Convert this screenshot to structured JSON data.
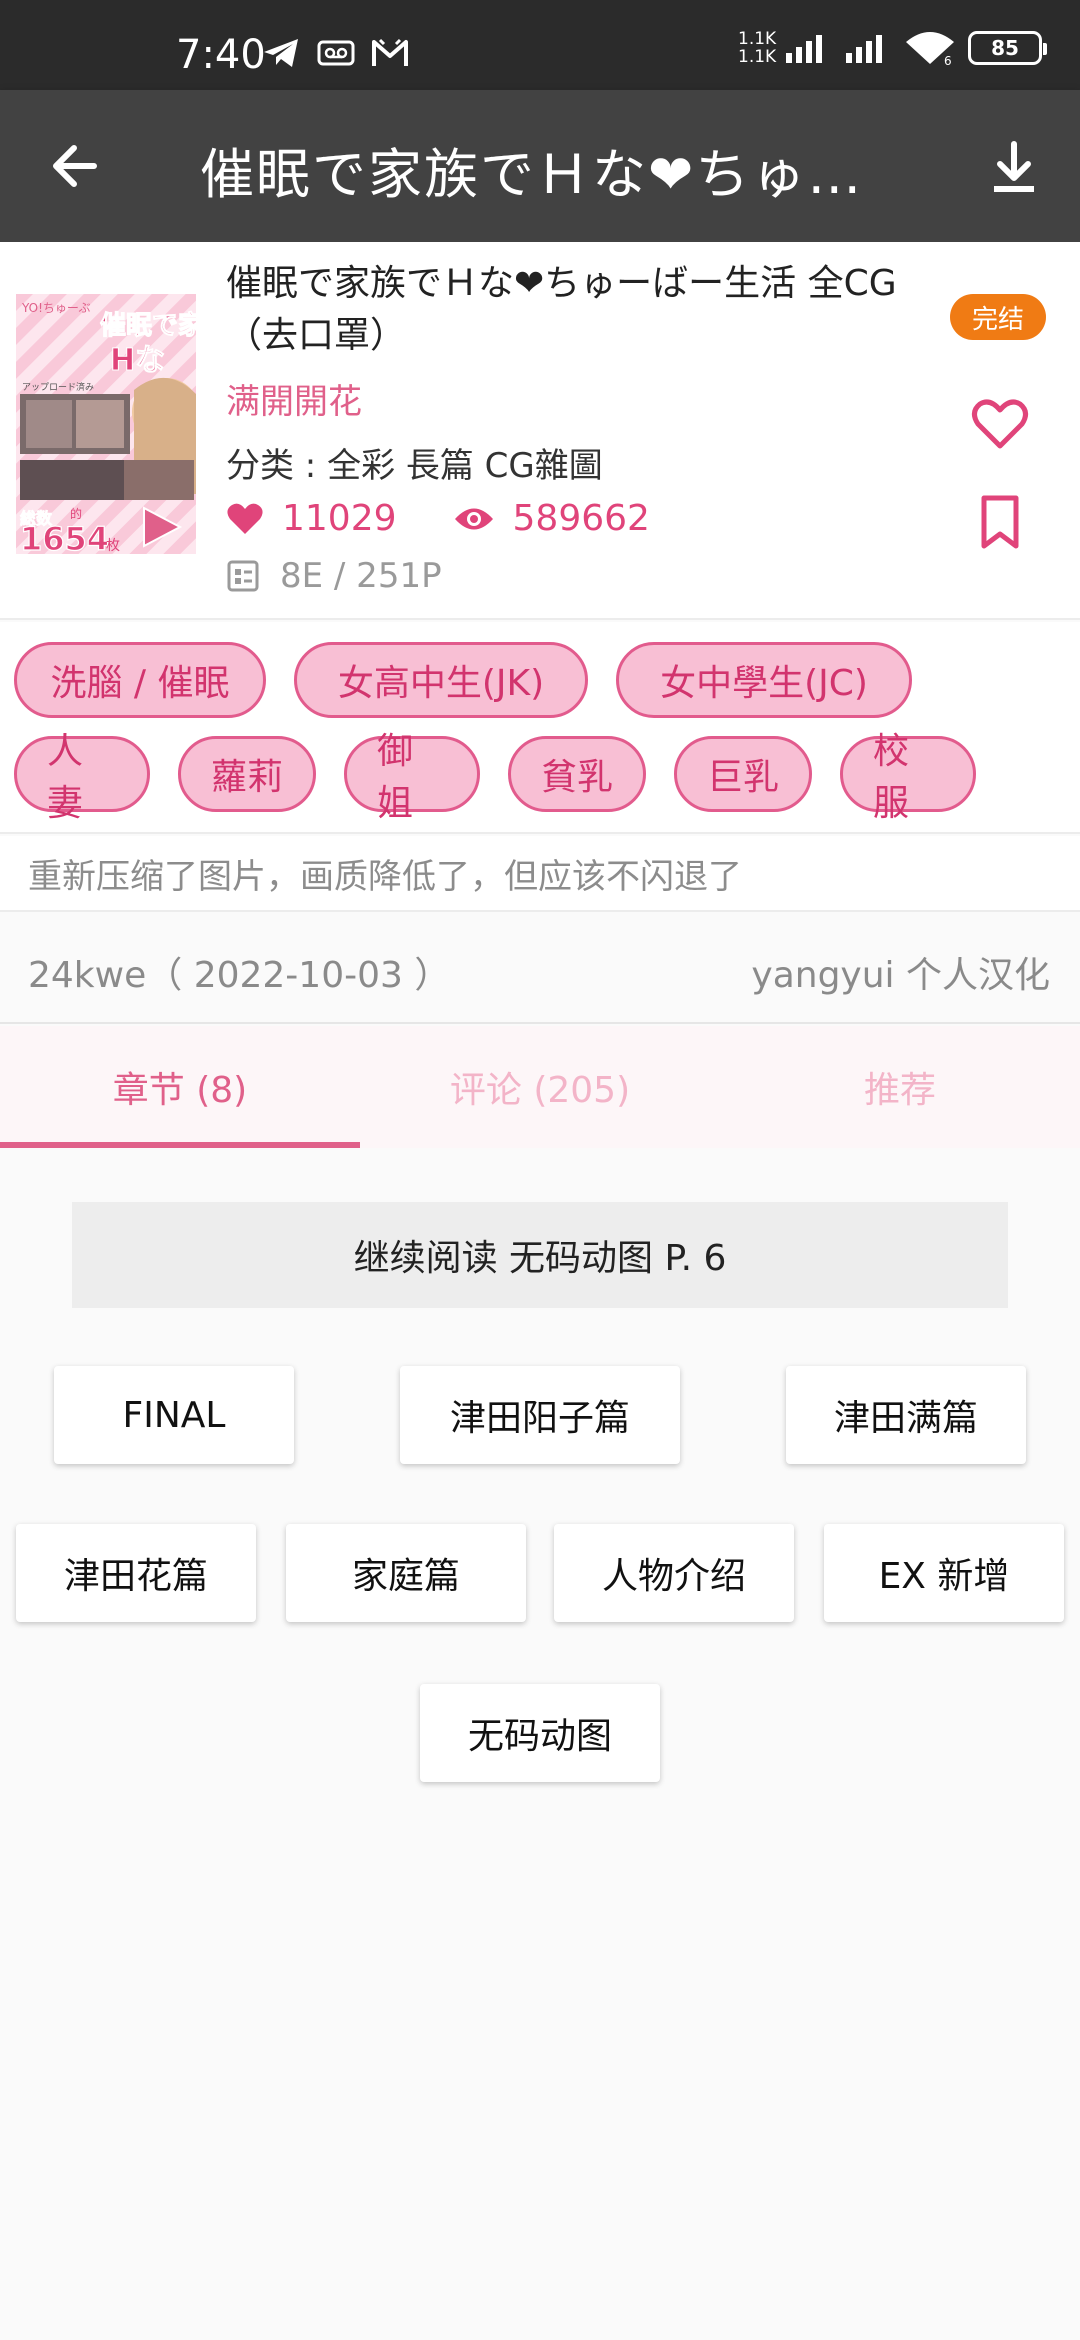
{
  "status_bar": {
    "time": "7:40",
    "net_up": "1.1K",
    "net_down": "1.1K",
    "battery": "85"
  },
  "app_bar": {
    "title": "催眠で家族でＨな❤ちゅーばー生活 全CG（去口罩）"
  },
  "book": {
    "title": "催眠で家族でＨな❤ちゅーばー生活 全CG（去口罩）",
    "author": "满開開花",
    "category": "分类 : 全彩 長篇 CG雜圖",
    "likes": "11029",
    "views": "589662",
    "pages": "8E / 251P",
    "status": "完结",
    "cover_texts": {
      "brand": "YO!ちゅーぶ",
      "title_main": "催眠で家",
      "title_sub": "Hな",
      "upload": "アップロード済み",
      "count_prefix": "総数",
      "count_unit": "的",
      "count": "1654",
      "count_suffix": "枚"
    }
  },
  "tags": [
    "洗腦 / 催眠",
    "女高中生(JK)",
    "女中學生(JC)",
    "人妻",
    "蘿莉",
    "御姐",
    "貧乳",
    "巨乳",
    "校服"
  ],
  "note": "重新压缩了图片，画质降低了，但应该不闪退了",
  "uploader": "24kwe（ 2022-10-03 ）",
  "translator": "yangyui 个人汉化",
  "tabs": [
    "章节 (8)",
    "评论 (205)",
    "推荐"
  ],
  "continue_label": "继续阅读 无码动图 P. 6",
  "chapters": [
    "FINAL",
    "津田阳子篇",
    "津田满篇",
    "津田花篇",
    "家庭篇",
    "人物介绍",
    "EX 新增",
    "无码动图"
  ],
  "colors": {
    "accent": "#e0608a",
    "tag_fill": "#f8bfd4",
    "tag_border": "#e25b8d",
    "badge": "#f07b14",
    "app_bar": "#424242"
  }
}
